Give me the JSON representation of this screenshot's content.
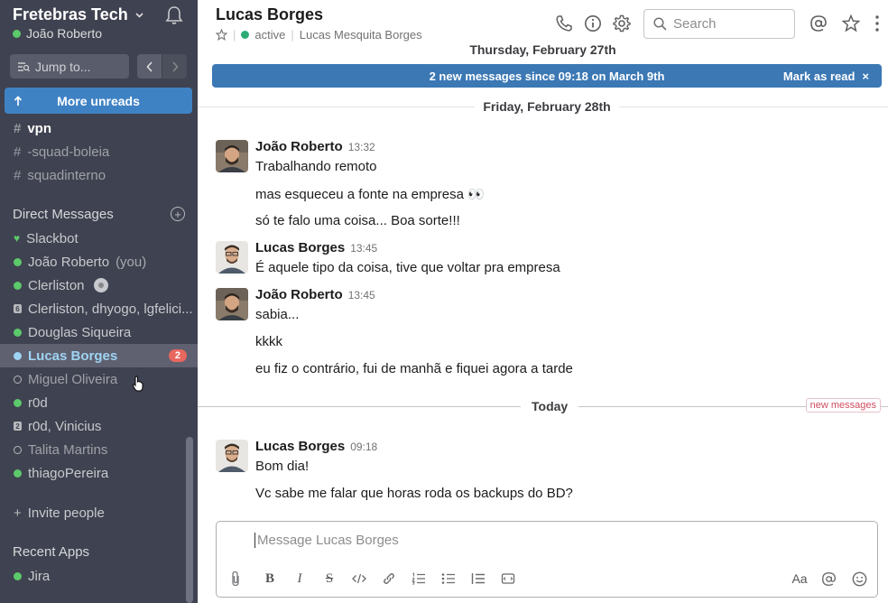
{
  "sidebar": {
    "workspace_name": "Fretebras Tech",
    "current_user": "João Roberto",
    "jump_to": "Jump to...",
    "more_unreads": "More unreads",
    "channels": [
      {
        "name": "vpn",
        "state": "bold"
      },
      {
        "name": "-squad-boleia",
        "state": "dim"
      },
      {
        "name": "squadinterno",
        "state": "dim"
      }
    ],
    "direct_messages_title": "Direct Messages",
    "dms": [
      {
        "name": "Slackbot"
      },
      {
        "name": "João Roberto",
        "suffix": "(you)"
      },
      {
        "name": "Clerliston"
      },
      {
        "name": "Clerliston, dhyogo, lgfelici...",
        "count": "6"
      },
      {
        "name": "Douglas Siqueira"
      },
      {
        "name": "Lucas Borges",
        "badge": "2"
      },
      {
        "name": "Miguel Oliveira"
      },
      {
        "name": "r0d"
      },
      {
        "name": "r0d, Vinicius",
        "count": "2"
      },
      {
        "name": "Talita Martins"
      },
      {
        "name": "thiagoPereira"
      }
    ],
    "invite_people": "Invite people",
    "recent_apps_title": "Recent Apps",
    "apps": [
      {
        "name": "Jira"
      }
    ]
  },
  "header": {
    "title": "Lucas Borges",
    "status": "active",
    "full_name": "Lucas Mesquita Borges",
    "search_placeholder": "Search"
  },
  "dates": {
    "first": "Thursday, February 27th",
    "second": "Friday, February 28th",
    "today": "Today"
  },
  "banner": {
    "text": "2 new messages since 09:18 on March 9th",
    "mark_read": "Mark as read",
    "close": "×"
  },
  "new_messages_label": "new messages",
  "messages": [
    {
      "sender": "João Roberto",
      "time": "13:32",
      "lines": [
        "Trabalhando remoto",
        "mas esqueceu a fonte na empresa 👀",
        "só te falo uma coisa... Boa sorte!!!"
      ]
    },
    {
      "sender": "Lucas Borges",
      "time": "13:45",
      "lines": [
        "É aquele tipo da coisa, tive que voltar pra empresa"
      ]
    },
    {
      "sender": "João Roberto",
      "time": "13:45",
      "lines": [
        "sabia...",
        "kkkk",
        "eu fiz o contrário, fui de manhã e fiquei agora a tarde"
      ]
    },
    {
      "sender": "Lucas Borges",
      "time": "09:18",
      "lines": [
        "Bom dia!",
        "Vc sabe me falar que horas roda os backups do BD?"
      ]
    }
  ],
  "composer": {
    "placeholder": "Message Lucas Borges",
    "format_label": "Aa"
  }
}
